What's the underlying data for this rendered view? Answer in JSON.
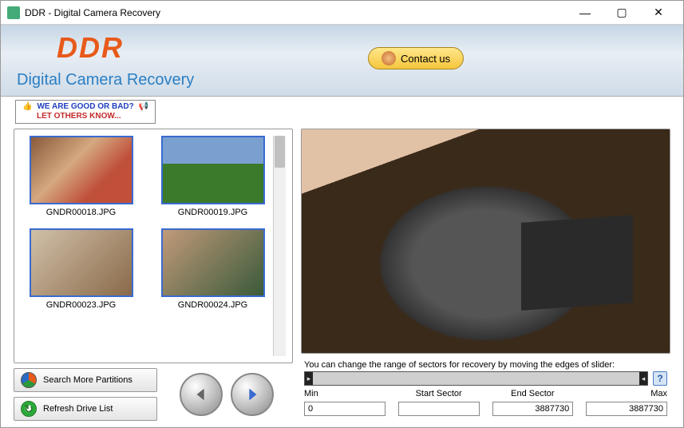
{
  "window": {
    "title": "DDR - Digital Camera Recovery"
  },
  "banner": {
    "logo": "DDR",
    "subtitle": "Digital Camera Recovery",
    "contact_label": "Contact us"
  },
  "feedback": {
    "line1": "WE ARE GOOD OR BAD?",
    "line2": "LET OTHERS KNOW..."
  },
  "thumbnails": [
    {
      "name": "GNDR00018.JPG",
      "cls": "p1"
    },
    {
      "name": "GNDR00019.JPG",
      "cls": "p2"
    },
    {
      "name": "GNDR00023.JPG",
      "cls": "p3"
    },
    {
      "name": "GNDR00024.JPG",
      "cls": "p4"
    }
  ],
  "buttons": {
    "search_partitions": "Search More Partitions",
    "refresh_drive": "Refresh Drive List"
  },
  "sector": {
    "instruction": "You can change the range of sectors for recovery by moving the edges of slider:",
    "min_label": "Min",
    "start_label": "Start Sector",
    "end_label": "End Sector",
    "max_label": "Max",
    "min_value": "0",
    "start_value": "",
    "end_value": "3887730",
    "max_value": "3887730",
    "help": "?"
  }
}
